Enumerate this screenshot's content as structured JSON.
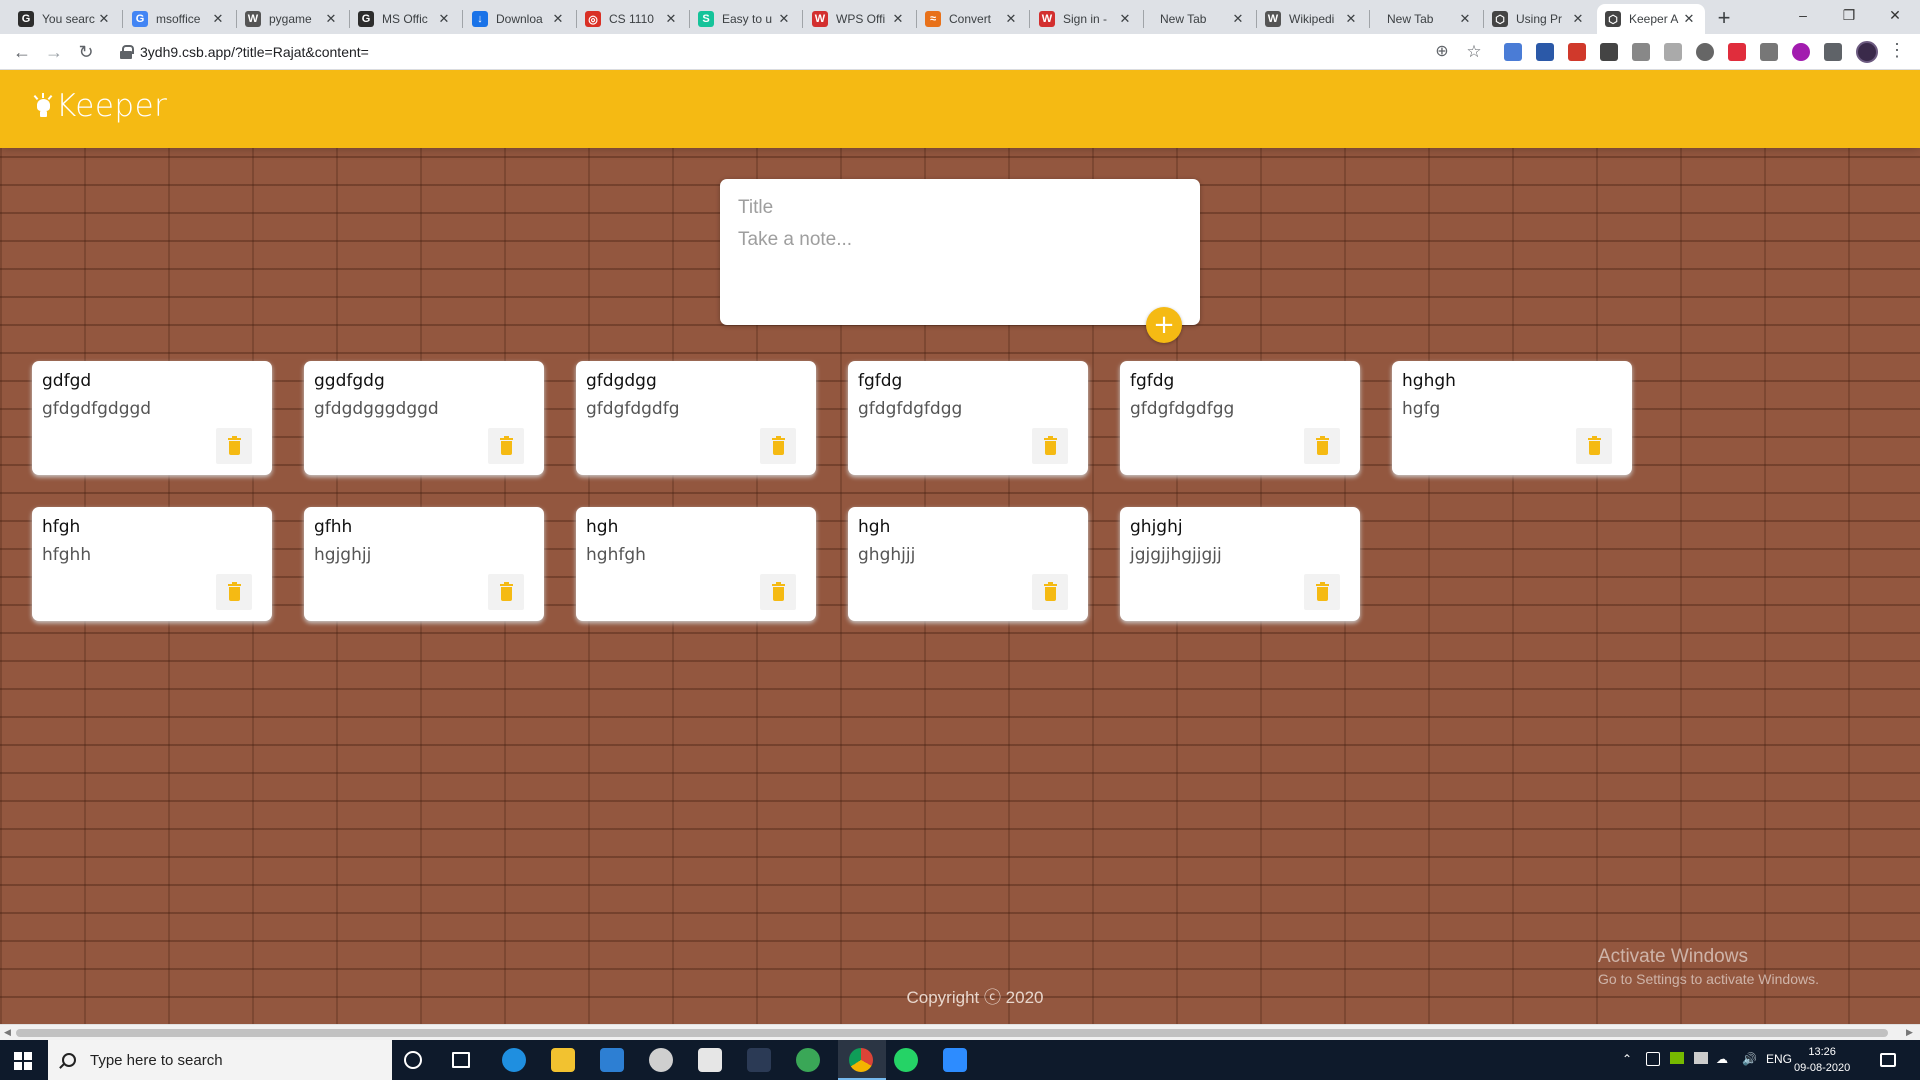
{
  "browser": {
    "tabs": [
      {
        "label": "You searc",
        "favicon": "G",
        "color": "#2d2d2d"
      },
      {
        "label": "msoffice",
        "favicon": "G",
        "color": "#4285f4"
      },
      {
        "label": "pygame",
        "favicon": "W",
        "color": "#555555"
      },
      {
        "label": "MS Offic",
        "favicon": "G",
        "color": "#2d2d2d"
      },
      {
        "label": "Downloa",
        "favicon": "↓",
        "color": "#1a73e8"
      },
      {
        "label": "CS 1110",
        "favicon": "◎",
        "color": "#d93025"
      },
      {
        "label": "Easy to u",
        "favicon": "S",
        "color": "#15c39a"
      },
      {
        "label": "WPS Offi",
        "favicon": "W",
        "color": "#d32f2f"
      },
      {
        "label": "Convert",
        "favicon": "≈",
        "color": "#e8711a"
      },
      {
        "label": "Sign in -",
        "favicon": "W",
        "color": "#d32f2f"
      },
      {
        "label": "New Tab",
        "favicon": "",
        "color": ""
      },
      {
        "label": "Wikipedi",
        "favicon": "W",
        "color": "#555555"
      },
      {
        "label": "New Tab",
        "favicon": "",
        "color": ""
      },
      {
        "label": "Using Pr",
        "favicon": "⬡",
        "color": "#444444"
      },
      {
        "label": "Keeper A",
        "favicon": "⬡",
        "color": "#444444"
      }
    ],
    "active_tab_index": 14,
    "url": "3ydh9.csb.app/?title=Rajat&content="
  },
  "app": {
    "logo_text": "Keeper",
    "brand_color": "#f5ba13",
    "create_note": {
      "title_placeholder": "Title",
      "content_placeholder": "Take a note...",
      "add_label": "+"
    },
    "notes": [
      {
        "title": "gdfgd",
        "content": "gfdgdfgdggd"
      },
      {
        "title": "ggdfgdg",
        "content": "gfdgdgggdggd"
      },
      {
        "title": "gfdgdgg",
        "content": "gfdgfdgdfg"
      },
      {
        "title": "fgfdg",
        "content": "gfdgfdgfdgg"
      },
      {
        "title": "fgfdg",
        "content": "gfdgfdgdfgg"
      },
      {
        "title": "hghgh",
        "content": "hgfg"
      },
      {
        "title": "hfgh",
        "content": "hfghh"
      },
      {
        "title": "gfhh",
        "content": "hgjghjj"
      },
      {
        "title": "hgh",
        "content": "hghfgh"
      },
      {
        "title": "hgh",
        "content": "ghghjjj"
      },
      {
        "title": "ghjghj",
        "content": "jgjgjjhgjjgjj"
      }
    ],
    "footer": "Copyright ⓒ 2020"
  },
  "watermark": {
    "line1": "Activate Windows",
    "line2": "Go to Settings to activate Windows."
  },
  "taskbar": {
    "search_placeholder": "Type here to search",
    "lang": "ENG",
    "time": "13:26",
    "date": "09-08-2020"
  }
}
